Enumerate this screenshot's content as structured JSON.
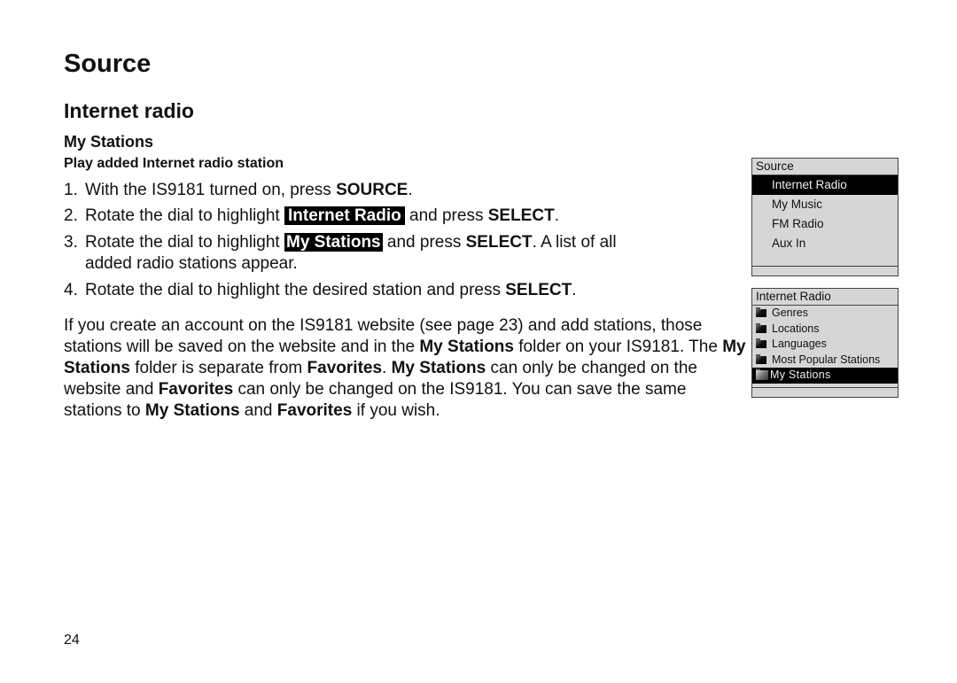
{
  "page": {
    "title": "Source",
    "section": "Internet radio",
    "subsection": "My Stations",
    "procedure_title": "Play added Internet radio station",
    "page_number": "24"
  },
  "steps": [
    {
      "num": "1.",
      "pre": "With the IS9181 turned on, press ",
      "bold": "SOURCE",
      "post": "."
    },
    {
      "num": "2.",
      "pre": "Rotate the dial to highlight ",
      "highlight": "Internet Radio",
      "mid": " and press ",
      "bold": "SELECT",
      "post": "."
    },
    {
      "num": "3.",
      "pre": "Rotate the dial to highlight ",
      "highlight": "My Stations",
      "mid": " and press ",
      "bold": "SELECT",
      "post": ". A list of all",
      "cont": "added radio stations appear."
    },
    {
      "num": "4.",
      "pre": "Rotate the dial to highlight the desired station and press ",
      "bold": "SELECT",
      "post": "."
    }
  ],
  "paragraph": {
    "t1": "If you create an account on the IS9181 website (see page 23) and add stations, those stations will be saved on the website and in the ",
    "b1": "My Stations",
    "t2": " folder on your IS9181. The ",
    "b2": "My Stations",
    "t3": " folder is separate from ",
    "b3": "Favorites",
    "t4": ". ",
    "b4": "My Stations",
    "t5": " can only be changed on the website and ",
    "b5": "Favorites",
    "t6": " can only be changed on the IS9181. You can save the same stations to ",
    "b6": "My Stations",
    "t7": " and ",
    "b7": "Favorites",
    "t8": " if you wish."
  },
  "screens": {
    "source": {
      "title": "Source",
      "items": [
        "Internet Radio",
        "My Music",
        "FM Radio",
        "Aux In"
      ],
      "selected": "Internet Radio"
    },
    "internet_radio": {
      "title": "Internet Radio",
      "items": [
        {
          "label": "Genres",
          "icon": "folder-icon"
        },
        {
          "label": "Locations",
          "icon": "folder-icon"
        },
        {
          "label": "Languages",
          "icon": "folder-icon"
        },
        {
          "label": "Most Popular Stations",
          "icon": "folder-icon"
        },
        {
          "label": "My Stations",
          "icon": "folder-icon"
        }
      ],
      "selected": "My Stations"
    }
  }
}
